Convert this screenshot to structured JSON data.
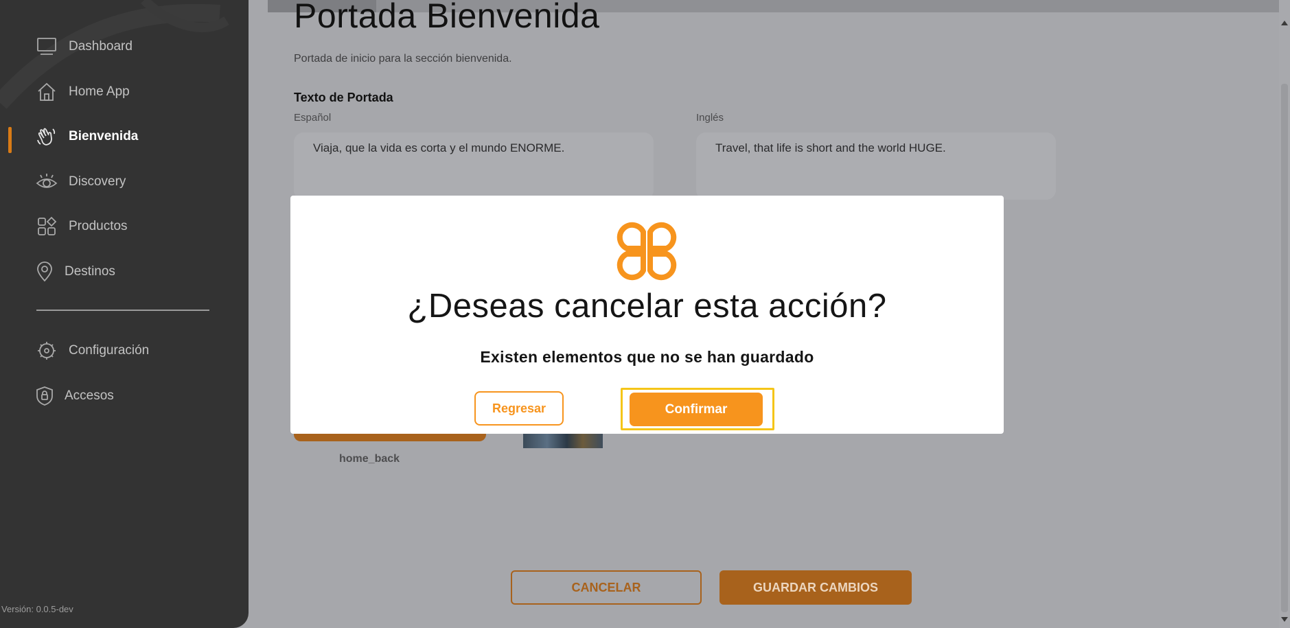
{
  "sidebar": {
    "items": [
      {
        "label": "Dashboard",
        "icon": "monitor-icon"
      },
      {
        "label": "Home App",
        "icon": "home-icon"
      },
      {
        "label": "Bienvenida",
        "icon": "waving-hand-icon",
        "active": true
      },
      {
        "label": "Discovery",
        "icon": "eye-icon"
      },
      {
        "label": "Productos",
        "icon": "grid-shapes-icon"
      },
      {
        "label": "Destinos",
        "icon": "map-pin-icon"
      },
      {
        "label": "Configuración",
        "icon": "gear-icon"
      },
      {
        "label": "Accesos",
        "icon": "shield-lock-icon"
      }
    ],
    "version": "Versión: 0.0.5-dev"
  },
  "page": {
    "title": "Portada Bienvenida",
    "subtitle": "Portada de inicio para la sección bienvenida.",
    "section_label": "Texto de Portada",
    "spanish_label": "Español",
    "spanish_value": "Viaja, que la vida es corta y el mundo ENORME.",
    "english_label": "Inglés",
    "english_value": "Travel, that life is short and the world HUGE.",
    "image_label": "home_back",
    "cancel_label": "CANCELAR",
    "save_label": "GUARDAR CAMBIOS"
  },
  "modal": {
    "title": "¿Deseas cancelar esta acción?",
    "message": "Existen elementos que no se han guardado",
    "back_label": "Regresar",
    "confirm_label": "Confirmar"
  },
  "colors": {
    "accent": "#f7941d",
    "accent_dimmed": "#a8621c",
    "sidebar_bg": "#333333",
    "highlight": "#f5c518"
  }
}
